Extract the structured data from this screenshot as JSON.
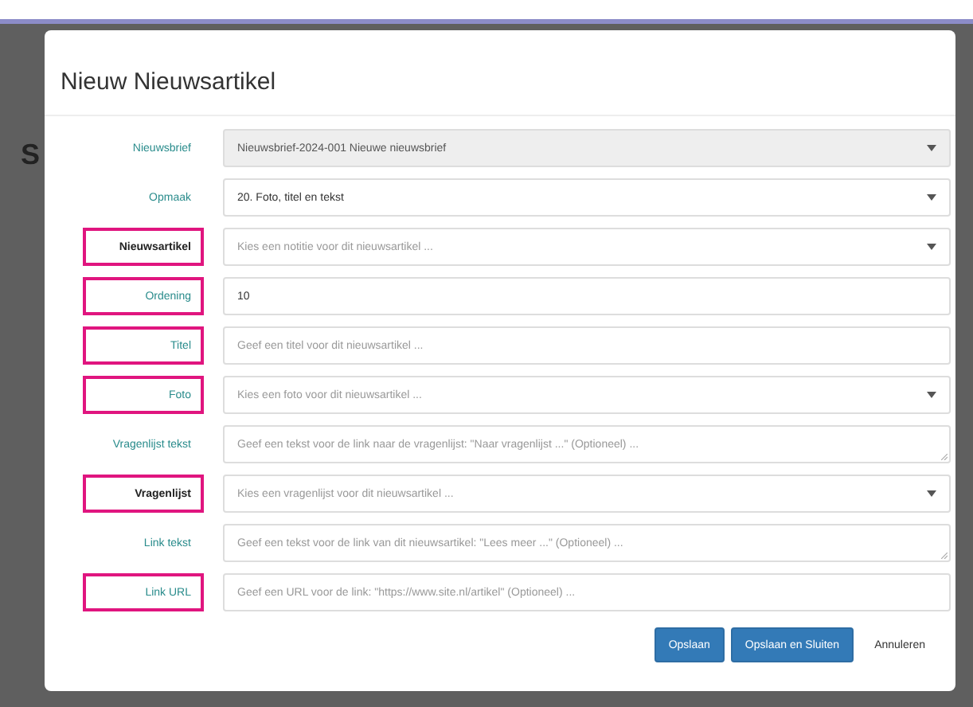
{
  "background": {
    "heading_fragment": "S"
  },
  "dialog": {
    "title": "Nieuw Nieuwsartikel",
    "fields": [
      {
        "label": "Nieuwsbrief",
        "kind": "select",
        "value": "Nieuwsbrief-2024-001 Nieuwe nieuwsbrief",
        "required": false,
        "highlighted": false,
        "disabled": true
      },
      {
        "label": "Opmaak",
        "kind": "select",
        "value": "20. Foto, titel en tekst",
        "required": false,
        "highlighted": false,
        "disabled": false
      },
      {
        "label": "Nieuwsartikel",
        "kind": "select",
        "placeholder": "Kies een notitie voor dit nieuwsartikel ...",
        "required": true,
        "highlighted": true,
        "disabled": false
      },
      {
        "label": "Ordening",
        "kind": "input",
        "value": "10",
        "required": false,
        "highlighted": true,
        "disabled": false
      },
      {
        "label": "Titel",
        "kind": "input",
        "placeholder": "Geef een titel voor dit nieuwsartikel ...",
        "required": false,
        "highlighted": true,
        "disabled": false
      },
      {
        "label": "Foto",
        "kind": "select",
        "placeholder": "Kies een foto voor dit nieuwsartikel ...",
        "required": false,
        "highlighted": true,
        "disabled": false
      },
      {
        "label": "Vragenlijst tekst",
        "kind": "textarea",
        "placeholder": "Geef een tekst voor de link naar de vragenlijst: \"Naar vragenlijst ...\" (Optioneel) ...",
        "required": false,
        "highlighted": false,
        "disabled": false
      },
      {
        "label": "Vragenlijst",
        "kind": "select",
        "placeholder": "Kies een vragenlijst voor dit nieuwsartikel ...",
        "required": true,
        "highlighted": true,
        "disabled": false
      },
      {
        "label": "Link tekst",
        "kind": "textarea",
        "placeholder": "Geef een tekst voor de link van dit nieuwsartikel: \"Lees meer ...\" (Optioneel) ...",
        "required": false,
        "highlighted": false,
        "disabled": false
      },
      {
        "label": "Link URL",
        "kind": "input",
        "placeholder": "Geef een URL voor de link: \"https://www.site.nl/artikel\" (Optioneel) ...",
        "required": false,
        "highlighted": true,
        "disabled": false
      }
    ],
    "buttons": [
      {
        "label": "Opslaan",
        "kind": "primary"
      },
      {
        "label": "Opslaan en Sluiten",
        "kind": "primary"
      },
      {
        "label": "Annuleren",
        "kind": "link"
      }
    ]
  }
}
